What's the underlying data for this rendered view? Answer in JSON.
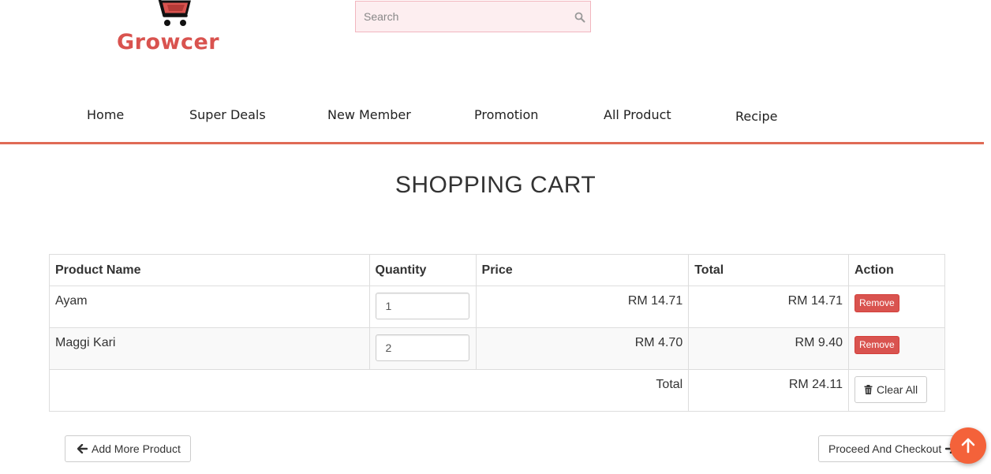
{
  "brand": {
    "name": "Growcer",
    "color": "#d9534f"
  },
  "search": {
    "placeholder": "Search",
    "value": "",
    "icon": "search-icon"
  },
  "nav": {
    "items": [
      {
        "label": "Home"
      },
      {
        "label": "Super Deals"
      },
      {
        "label": "New Member"
      },
      {
        "label": "Promotion"
      },
      {
        "label": "All Product"
      },
      {
        "label": "Recipe"
      }
    ],
    "accent_color": "#e06a55"
  },
  "page": {
    "title": "SHOPPING CART"
  },
  "cart": {
    "columns": [
      "Product Name",
      "Quantity",
      "Price",
      "Total",
      "Action"
    ],
    "rows": [
      {
        "product": "Ayam",
        "quantity": "1",
        "price": "RM 14.71",
        "total": "RM 14.71",
        "action": "Remove"
      },
      {
        "product": "Maggi Kari",
        "quantity": "2",
        "price": "RM 4.70",
        "total": "RM 9.40",
        "action": "Remove"
      }
    ],
    "summary": {
      "label": "Total",
      "value": "RM 24.11",
      "clear_label": "Clear All"
    }
  },
  "actions": {
    "add_more_label": "Add More Product",
    "checkout_label": "Proceed And Checkout"
  },
  "colors": {
    "danger": "#d9534f",
    "scroll_top": "#f4623a"
  }
}
